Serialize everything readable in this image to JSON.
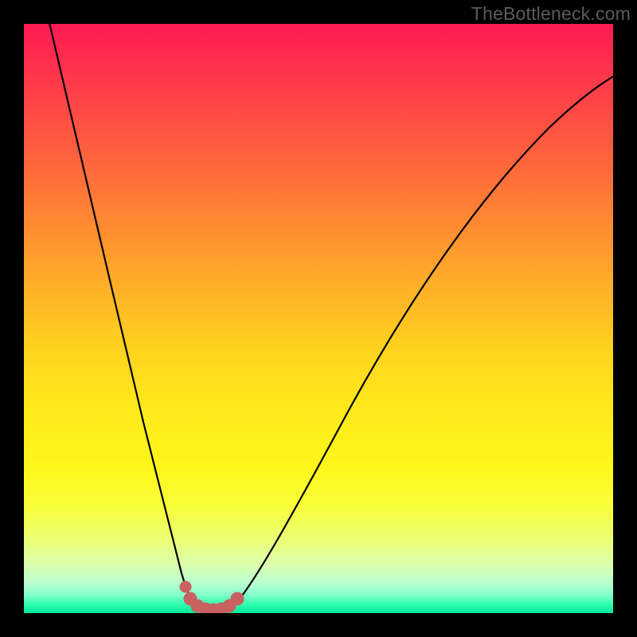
{
  "watermark": "TheBottleneck.com",
  "colors": {
    "background": "#000000",
    "gradient_top": "#ff1a53",
    "gradient_mid": "#ffe91a",
    "gradient_bottom": "#00e89a",
    "curve": "#000000",
    "marker": "#c96161"
  },
  "chart_data": {
    "type": "line",
    "title": "",
    "xlabel": "",
    "ylabel": "",
    "xlim": [
      0,
      1
    ],
    "ylim": [
      0,
      1
    ],
    "series": [
      {
        "name": "bottleneck-curve",
        "x": [
          0.0,
          0.06,
          0.12,
          0.18,
          0.22,
          0.25,
          0.28,
          0.3,
          0.32,
          0.34,
          0.36,
          0.4,
          0.46,
          0.54,
          0.62,
          0.72,
          0.84,
          1.0
        ],
        "y": [
          1.0,
          0.8,
          0.58,
          0.36,
          0.2,
          0.1,
          0.03,
          0.0,
          0.0,
          0.0,
          0.02,
          0.08,
          0.2,
          0.35,
          0.48,
          0.62,
          0.75,
          0.88
        ]
      }
    ],
    "markers": {
      "name": "highlight-dots",
      "color": "#c96161",
      "points": [
        {
          "x": 0.27,
          "y": 0.035
        },
        {
          "x": 0.283,
          "y": 0.01
        },
        {
          "x": 0.296,
          "y": 0.004
        },
        {
          "x": 0.309,
          "y": 0.002
        },
        {
          "x": 0.322,
          "y": 0.002
        },
        {
          "x": 0.335,
          "y": 0.004
        },
        {
          "x": 0.348,
          "y": 0.01
        },
        {
          "x": 0.36,
          "y": 0.022
        }
      ]
    },
    "annotations": []
  }
}
